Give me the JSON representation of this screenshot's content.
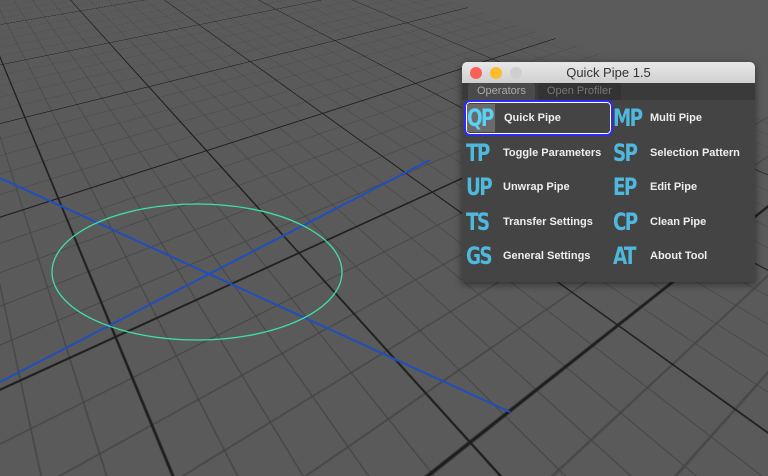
{
  "window": {
    "title": "Quick Pipe 1.5"
  },
  "tabs": [
    {
      "label": "Operators",
      "active": true
    },
    {
      "label": "Open Profiler",
      "active": false
    }
  ],
  "tools": [
    {
      "abbr": "QP",
      "label": "Quick Pipe",
      "selected": true
    },
    {
      "abbr": "MP",
      "label": "Multi Pipe"
    },
    {
      "abbr": "TP",
      "label": "Toggle Parameters"
    },
    {
      "abbr": "SP",
      "label": "Selection Pattern"
    },
    {
      "abbr": "UP",
      "label": "Unwrap Pipe"
    },
    {
      "abbr": "EP",
      "label": "Edit Pipe"
    },
    {
      "abbr": "TS",
      "label": "Transfer Settings"
    },
    {
      "abbr": "CP",
      "label": "Clean Pipe"
    },
    {
      "abbr": "GS",
      "label": "General Settings"
    },
    {
      "abbr": "AT",
      "label": "About Tool"
    }
  ],
  "colors": {
    "accent": "#4fb8dd",
    "axis": "#1f4fbf",
    "circle": "#3fe0a0",
    "selection": "#2b2bff"
  }
}
